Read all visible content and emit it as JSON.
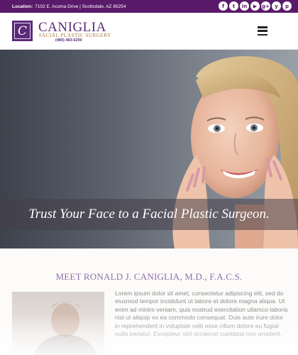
{
  "topbar": {
    "location_label": "Location:",
    "location_text": "7102 E. Acoma Drive | Scottsdale, AZ 85254",
    "social": [
      {
        "icon": "facebook-icon",
        "glyph": "f"
      },
      {
        "icon": "twitter-icon",
        "glyph": "t"
      },
      {
        "icon": "linkedin-icon",
        "glyph": "in"
      },
      {
        "icon": "youtube-icon",
        "glyph": "▶"
      },
      {
        "icon": "google-plus-icon",
        "glyph": "g+"
      },
      {
        "icon": "yelp-icon",
        "glyph": "y"
      },
      {
        "icon": "pinterest-icon",
        "glyph": "p"
      }
    ]
  },
  "header": {
    "logo_letter": "C",
    "brand_name": "CANIGLIA",
    "brand_subtitle": "FACIAL PLASTIC SURGERY",
    "phone": "(480) 483-6200"
  },
  "hero": {
    "tagline": "Trust Your Face to a Facial Plastic Surgeon."
  },
  "about": {
    "heading": "MEET RONALD J. CANIGLIA, M.D., F.A.C.S.",
    "body": "Lorem ipsum dolor sit amet, consectetur adipiscing elit, sed do eiusmod tempor incididunt ut labore et dolore magna aliqua. Ut enim ad minim veniam, quis nostrud exercitation ullamco laboris nisi ut aliquip ex ea commodo consequat. Duis aute irure dolor in reprehenderit in voluptate velit esse cillum dolore eu fugiat nulla pariatur. Excepteur sint occaecat cupidatat non proident."
  },
  "colors": {
    "brand_purple": "#5a1a6a",
    "gold": "#a27838",
    "heading_lavender": "#8c6fa6"
  }
}
